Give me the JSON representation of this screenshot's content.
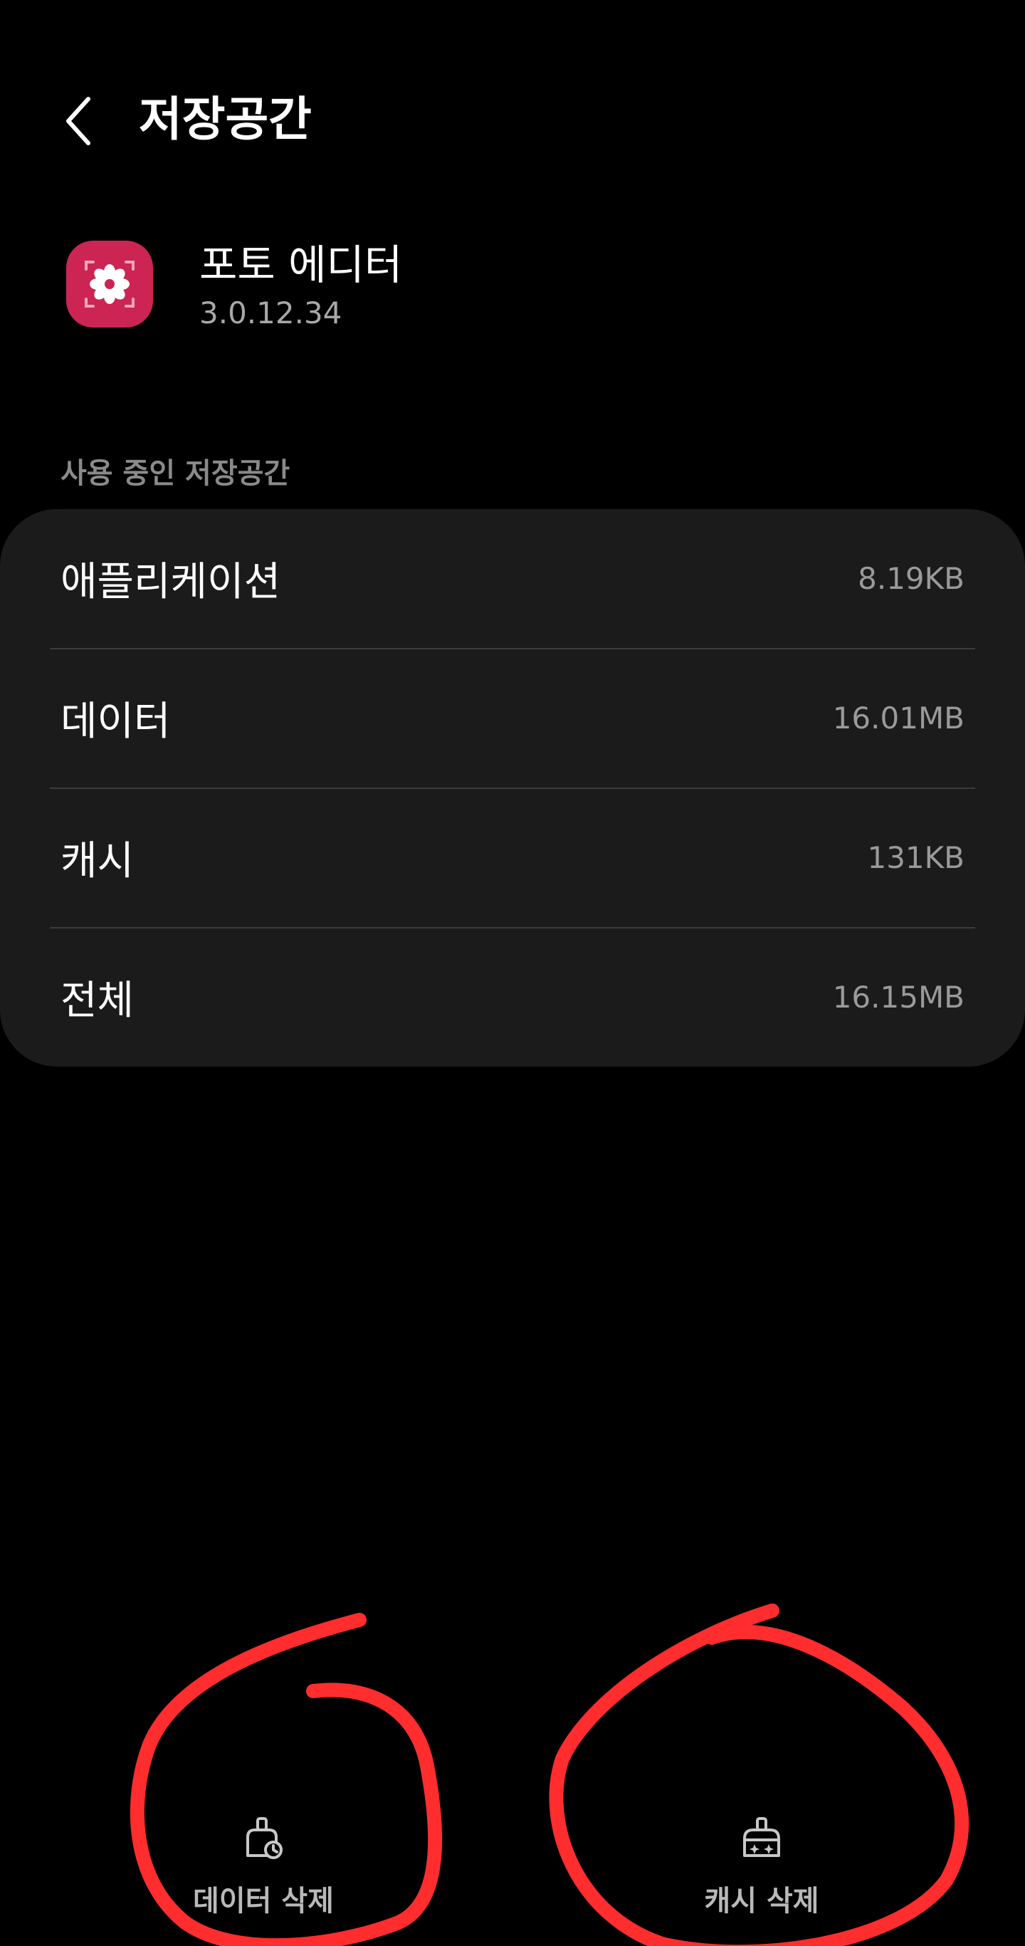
{
  "header": {
    "title": "저장공간",
    "back_icon": "chevron-left-icon"
  },
  "app": {
    "name": "포토 에디터",
    "version": "3.0.12.34",
    "icon": "photo-editor-flower-icon",
    "icon_color": "#cc2553"
  },
  "storage": {
    "section_title": "사용 중인 저장공간",
    "rows": [
      {
        "label": "애플리케이션",
        "value": "8.19KB"
      },
      {
        "label": "데이터",
        "value": "16.01MB"
      },
      {
        "label": "캐시",
        "value": "131KB"
      },
      {
        "label": "전체",
        "value": "16.15MB"
      }
    ]
  },
  "actions": {
    "clear_data": {
      "label": "데이터 삭제",
      "icon": "broom-clear-data-icon"
    },
    "clear_cache": {
      "label": "캐시 삭제",
      "icon": "broom-sparkle-clear-cache-icon"
    }
  },
  "colors": {
    "background": "#000000",
    "card": "#1b1b1b",
    "annotation": "#ff2d2d"
  }
}
